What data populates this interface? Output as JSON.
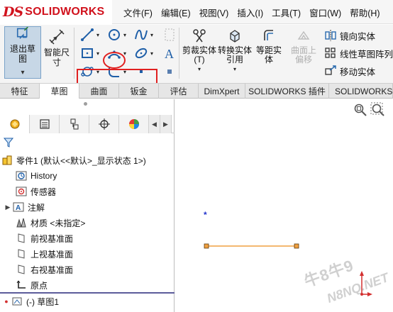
{
  "app": {
    "logo_ds": "DS",
    "logo_word": "SOLIDWORKS"
  },
  "menu": [
    {
      "label": "文件(F)"
    },
    {
      "label": "编辑(E)"
    },
    {
      "label": "视图(V)"
    },
    {
      "label": "插入(I)"
    },
    {
      "label": "工具(T)"
    },
    {
      "label": "窗口(W)"
    },
    {
      "label": "帮助(H)"
    }
  ],
  "ribbon": {
    "exit_sketch": "退出草图",
    "smart_dim": "智能尺寸",
    "trim": "剪裁实体(T)",
    "convert": "转换实体引用",
    "offset": "等距实体",
    "surface_offset": "曲面上偏移",
    "mirror": "镜向实体",
    "linear_pattern": "线性草图阵列",
    "move": "移动实体"
  },
  "tabs": [
    "特征",
    "草图",
    "曲面",
    "钣金",
    "评估",
    "DimXpert",
    "SOLIDWORKS 插件",
    "SOLIDWORKS MBD"
  ],
  "active_tab": "草图",
  "tree": {
    "root": "零件1 (默认<<默认>_显示状态 1>)",
    "items": [
      {
        "label": "History",
        "icon": "history-icon"
      },
      {
        "label": "传感器",
        "icon": "sensor-icon"
      },
      {
        "label": "注解",
        "icon": "annotation-icon",
        "expandable": true
      },
      {
        "label": "材质 <未指定>",
        "icon": "material-icon"
      },
      {
        "label": "前视基准面",
        "icon": "plane-icon"
      },
      {
        "label": "上视基准面",
        "icon": "plane-icon"
      },
      {
        "label": "右视基准面",
        "icon": "plane-icon"
      },
      {
        "label": "原点",
        "icon": "origin-icon"
      },
      {
        "label": "(-) 草图1",
        "icon": "sketch-icon"
      }
    ]
  },
  "graphics": {
    "origin_marker": "*",
    "watermark_line1": "牛8牛9",
    "watermark_line2": "N8NQ.NET"
  },
  "colors": {
    "brand": "#d1121d",
    "highlight": "#e02020",
    "sketch_line": "#f0a040",
    "active_button": "#c7d7e6"
  }
}
